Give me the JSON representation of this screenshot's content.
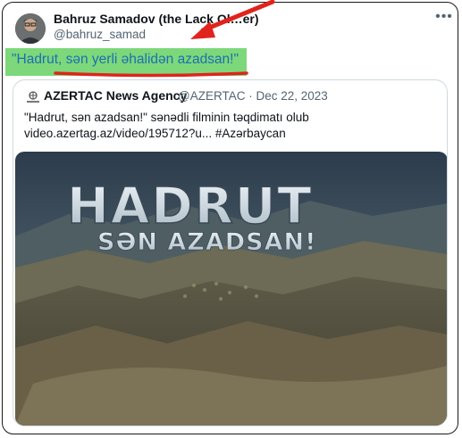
{
  "tweet": {
    "author_name": "Bahruz Samadov (the Lack Ol…er)",
    "author_handle": "@bahruz_samad",
    "more_icon": "more-icon",
    "text": "\"Hadrut, sən yerli əhalidən azadsan!\""
  },
  "quote": {
    "source_name": "AZERTAC News Agency",
    "source_handle": "@AZERTAC",
    "separator": "·",
    "date": "Dec 22, 2023",
    "text_line1": "\"Hadrut, sən azadsan!\" sənədli filminin təqdimatı olub",
    "text_line2": "video.azertag.az/video/195712?u... #Azərbaycan",
    "media_title": "HADRUT",
    "media_subtitle": "SƏN AZADSAN!"
  },
  "colors": {
    "highlight": "#7cd87a",
    "annotation_red": "#e0231c",
    "tweet_text": "#1d6fb0"
  }
}
